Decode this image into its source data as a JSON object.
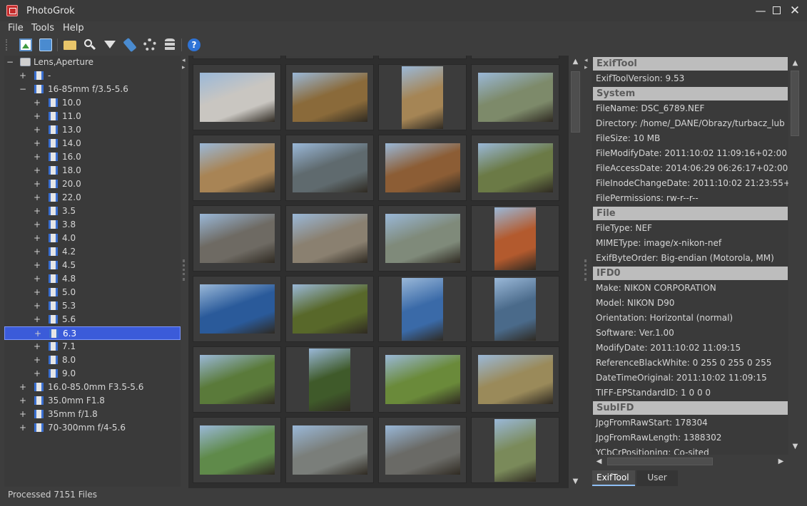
{
  "window": {
    "title": "PhotoGrok",
    "minimize_icon": "minimize-icon",
    "maximize_icon": "maximize-icon",
    "close_icon": "close-icon"
  },
  "menu": [
    "File",
    "Tools",
    "Help"
  ],
  "toolbar": {
    "icons": [
      "open-image-icon",
      "open-multiple-icon",
      "open-folder-icon",
      "search-icon",
      "filter-icon",
      "tag-icon",
      "settings-gear-icon",
      "database-icon",
      "help-icon"
    ],
    "help_glyph": "?"
  },
  "tree": {
    "root": "Lens,Aperture",
    "items": [
      {
        "label": "-",
        "level": 1,
        "expander": "+"
      },
      {
        "label": "16-85mm f/3.5-5.6",
        "level": 1,
        "expander": "−"
      },
      {
        "label": "10.0",
        "level": 2,
        "expander": "+"
      },
      {
        "label": "11.0",
        "level": 2,
        "expander": "+"
      },
      {
        "label": "13.0",
        "level": 2,
        "expander": "+"
      },
      {
        "label": "14.0",
        "level": 2,
        "expander": "+"
      },
      {
        "label": "16.0",
        "level": 2,
        "expander": "+"
      },
      {
        "label": "18.0",
        "level": 2,
        "expander": "+"
      },
      {
        "label": "20.0",
        "level": 2,
        "expander": "+"
      },
      {
        "label": "22.0",
        "level": 2,
        "expander": "+"
      },
      {
        "label": "3.5",
        "level": 2,
        "expander": "+"
      },
      {
        "label": "3.8",
        "level": 2,
        "expander": "+"
      },
      {
        "label": "4.0",
        "level": 2,
        "expander": "+"
      },
      {
        "label": "4.2",
        "level": 2,
        "expander": "+"
      },
      {
        "label": "4.5",
        "level": 2,
        "expander": "+"
      },
      {
        "label": "4.8",
        "level": 2,
        "expander": "+"
      },
      {
        "label": "5.0",
        "level": 2,
        "expander": "+"
      },
      {
        "label": "5.3",
        "level": 2,
        "expander": "+"
      },
      {
        "label": "5.6",
        "level": 2,
        "expander": "+"
      },
      {
        "label": "6.3",
        "level": 2,
        "expander": "+",
        "selected": true
      },
      {
        "label": "7.1",
        "level": 2,
        "expander": "+"
      },
      {
        "label": "8.0",
        "level": 2,
        "expander": "+"
      },
      {
        "label": "9.0",
        "level": 2,
        "expander": "+"
      },
      {
        "label": "16.0-85.0mm F3.5-5.6",
        "level": 1,
        "expander": "+"
      },
      {
        "label": "35.0mm F1.8",
        "level": 1,
        "expander": "+"
      },
      {
        "label": "35mm f/1.8",
        "level": 1,
        "expander": "+"
      },
      {
        "label": "70-300mm f/4-5.6",
        "level": 1,
        "expander": "+"
      }
    ]
  },
  "thumbnails": {
    "orientations": [
      "landscape",
      "landscape",
      "portrait",
      "landscape",
      "landscape",
      "landscape",
      "landscape",
      "landscape",
      "landscape",
      "landscape",
      "landscape",
      "portrait",
      "landscape",
      "landscape",
      "portrait",
      "portrait",
      "landscape",
      "portrait",
      "landscape",
      "landscape",
      "landscape",
      "landscape",
      "landscape",
      "portrait"
    ],
    "colors": [
      "#c9c6c1",
      "#8a6a3a",
      "#a58555",
      "#7d8a6a",
      "#a88455",
      "#5f6a6e",
      "#8c5d35",
      "#6b7a46",
      "#6e6a63",
      "#8a8070",
      "#7f8a7a",
      "#b35a2e",
      "#2a5a9a",
      "#58682a",
      "#3a6aa8",
      "#4a6a8a",
      "#5a7a3a",
      "#3f5a2a",
      "#6a8a3a",
      "#9a8a5a",
      "#5f8a4a",
      "#7a7e7a",
      "#6a6a66",
      "#7a8a5a"
    ]
  },
  "properties": {
    "rows": [
      {
        "type": "header",
        "text": "ExifTool"
      },
      {
        "type": "row",
        "text": "ExifToolVersion: 9.53"
      },
      {
        "type": "header",
        "text": "System"
      },
      {
        "type": "row",
        "text": "FileName: DSC_6789.NEF"
      },
      {
        "type": "row",
        "text": "Directory: /home/_DANE/Obrazy/turbacz_lub"
      },
      {
        "type": "row",
        "text": "FileSize: 10 MB"
      },
      {
        "type": "row",
        "text": "FileModifyDate: 2011:10:02 11:09:16+02:00"
      },
      {
        "type": "row",
        "text": "FileAccessDate: 2014:06:29 06:26:17+02:00"
      },
      {
        "type": "row",
        "text": "FileInodeChangeDate: 2011:10:02 21:23:55+02"
      },
      {
        "type": "row",
        "text": "FilePermissions: rw-r--r--"
      },
      {
        "type": "header",
        "text": "File"
      },
      {
        "type": "row",
        "text": "FileType: NEF"
      },
      {
        "type": "row",
        "text": "MIMEType: image/x-nikon-nef"
      },
      {
        "type": "row",
        "text": "ExifByteOrder: Big-endian (Motorola, MM)"
      },
      {
        "type": "header",
        "text": "IFD0"
      },
      {
        "type": "row",
        "text": "Make: NIKON CORPORATION"
      },
      {
        "type": "row",
        "text": "Model: NIKON D90"
      },
      {
        "type": "row",
        "text": "Orientation: Horizontal (normal)"
      },
      {
        "type": "row",
        "text": "Software: Ver.1.00"
      },
      {
        "type": "row",
        "text": "ModifyDate: 2011:10:02 11:09:15"
      },
      {
        "type": "row",
        "text": "ReferenceBlackWhite: 0 255 0 255 0 255"
      },
      {
        "type": "row",
        "text": "DateTimeOriginal: 2011:10:02 11:09:15"
      },
      {
        "type": "row",
        "text": "TIFF-EPStandardID: 1 0 0 0"
      },
      {
        "type": "header",
        "text": "SubIFD"
      },
      {
        "type": "row",
        "text": "JpgFromRawStart: 178304"
      },
      {
        "type": "row",
        "text": "JpgFromRawLength: 1388302"
      },
      {
        "type": "row",
        "text": "YCbCrPositioning: Co-sited"
      }
    ],
    "tabs": [
      "ExifTool",
      "User"
    ],
    "active_tab": "ExifTool"
  },
  "status": "Processed 7151 Files",
  "colors": {
    "selection": "#3b5bd9",
    "section_header_bg": "#bdbdbd",
    "window_bg": "#3d3d3d"
  }
}
